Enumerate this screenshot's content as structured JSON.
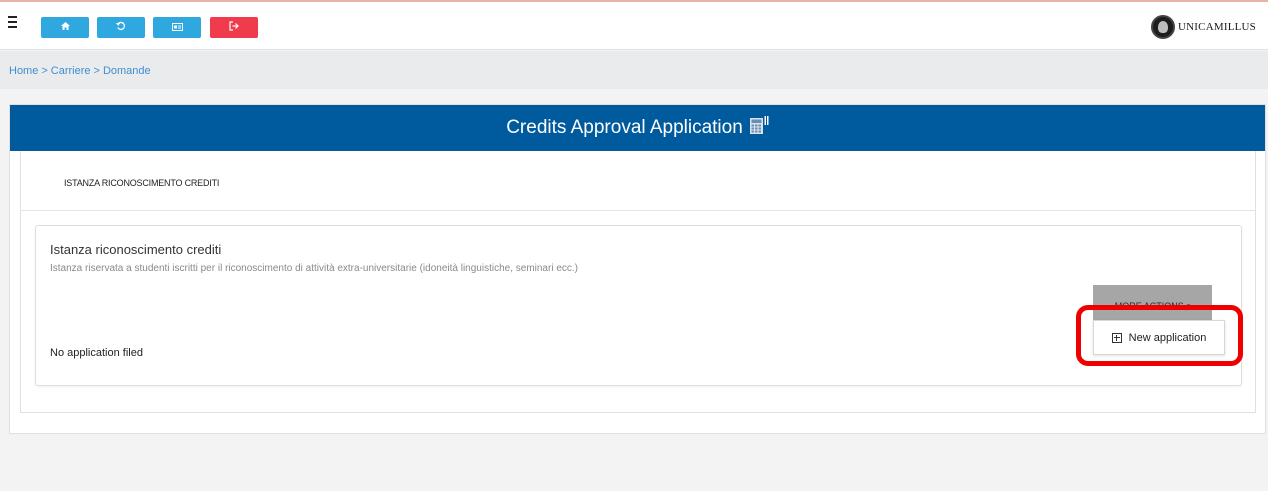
{
  "topbar": {
    "buttons": [
      {
        "name": "home-button",
        "icon": "home-icon",
        "glyph": "⌂",
        "color": "#2fa8e0"
      },
      {
        "name": "history-button",
        "icon": "history-icon",
        "glyph": "⟲",
        "color": "#2fa8e0"
      },
      {
        "name": "id-card-button",
        "icon": "id-card-icon",
        "glyph": "▭",
        "color": "#2fa8e0"
      },
      {
        "name": "logout-button",
        "icon": "logout-icon",
        "glyph": "⇥",
        "color": "#ef3b4b"
      }
    ],
    "logo_text": "UNICAMILLUS"
  },
  "breadcrumb": {
    "items": [
      "Home",
      "Carriere",
      "Domande"
    ],
    "separator": ">"
  },
  "panel": {
    "title": "Credits Approval Application",
    "header_color": "#005a9e",
    "tab_label": "ISTANZA RICONOSCIMENTO CREDITI"
  },
  "card": {
    "title": "Istanza riconoscimento crediti",
    "subtitle": "Istanza riservata a studenti iscritti per il riconoscimento di attività extra-universitarie (idoneità linguistiche, seminari ecc.)",
    "more_actions_label": "MORE ACTIONS",
    "new_application_label": "New application",
    "empty_text": "No application filed"
  },
  "highlight_color": "#ee0000"
}
